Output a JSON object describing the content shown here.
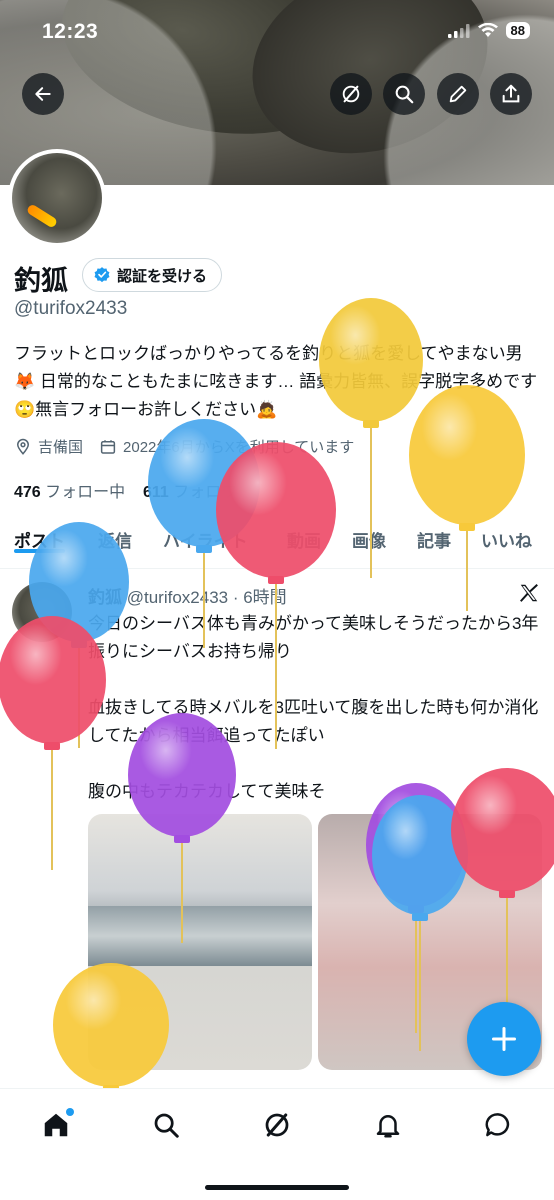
{
  "status": {
    "time": "12:23",
    "battery": "88"
  },
  "profile": {
    "name": "釣狐",
    "verify_label": "認証を受ける",
    "handle": "@turifox2433",
    "bio": "フラットとロックばっかりやってるを釣りと狐を愛してやまない男🦊 日常的なこともたまに呟きます… 語彙力皆無、誤字脱字多めです🙄無言フォローお許しください🙇",
    "location": "吉備国",
    "joined": "2022年6月からXを利用しています",
    "following_count": "476",
    "following_label": "フォロー中",
    "followers_count": "611",
    "followers_label": "フォロワー"
  },
  "tabs": [
    {
      "label": "ポスト"
    },
    {
      "label": "返信"
    },
    {
      "label": "ハイライト"
    },
    {
      "label": "動画"
    },
    {
      "label": "画像"
    },
    {
      "label": "記事"
    },
    {
      "label": "いいね"
    }
  ],
  "post": {
    "name": "釣狐",
    "handle": "@turifox2433",
    "time": "· 6時間",
    "lines": [
      "今日のシーバス体も青みがかって美味しそうだったから3年振りにシーバスお持ち帰り",
      "血抜きしてる時メバルを3匹吐いて腹を出した時も何か消化してたから相当餌追ってたぽい",
      "腹の中もテカテカしてて美味そ"
    ]
  },
  "icons": {
    "back": "arrow-left-icon",
    "grok": "grok-icon",
    "search": "search-icon",
    "edit": "pencil-icon",
    "share": "share-icon",
    "location": "location-pin-icon",
    "calendar": "calendar-icon",
    "verified": "verified-badge-icon",
    "compose": "plus-icon",
    "nav": [
      "home-icon",
      "search-icon",
      "grok-icon",
      "bell-icon",
      "mail-icon"
    ]
  },
  "colors": {
    "accent": "#1d9bf0",
    "text": "#0f1419",
    "secondary": "#536471"
  },
  "balloons": [
    {
      "color": "#f2c93a"
    },
    {
      "color": "#f7c93a"
    },
    {
      "color": "#4aa8ee"
    },
    {
      "color": "#ee4d6a"
    },
    {
      "color": "#4aa8ee"
    },
    {
      "color": "#ee4d6a"
    },
    {
      "color": "#a24de0"
    },
    {
      "color": "#a24de0"
    },
    {
      "color": "#4aa8ee"
    },
    {
      "color": "#ee4d6a"
    },
    {
      "color": "#f7c93a"
    }
  ]
}
